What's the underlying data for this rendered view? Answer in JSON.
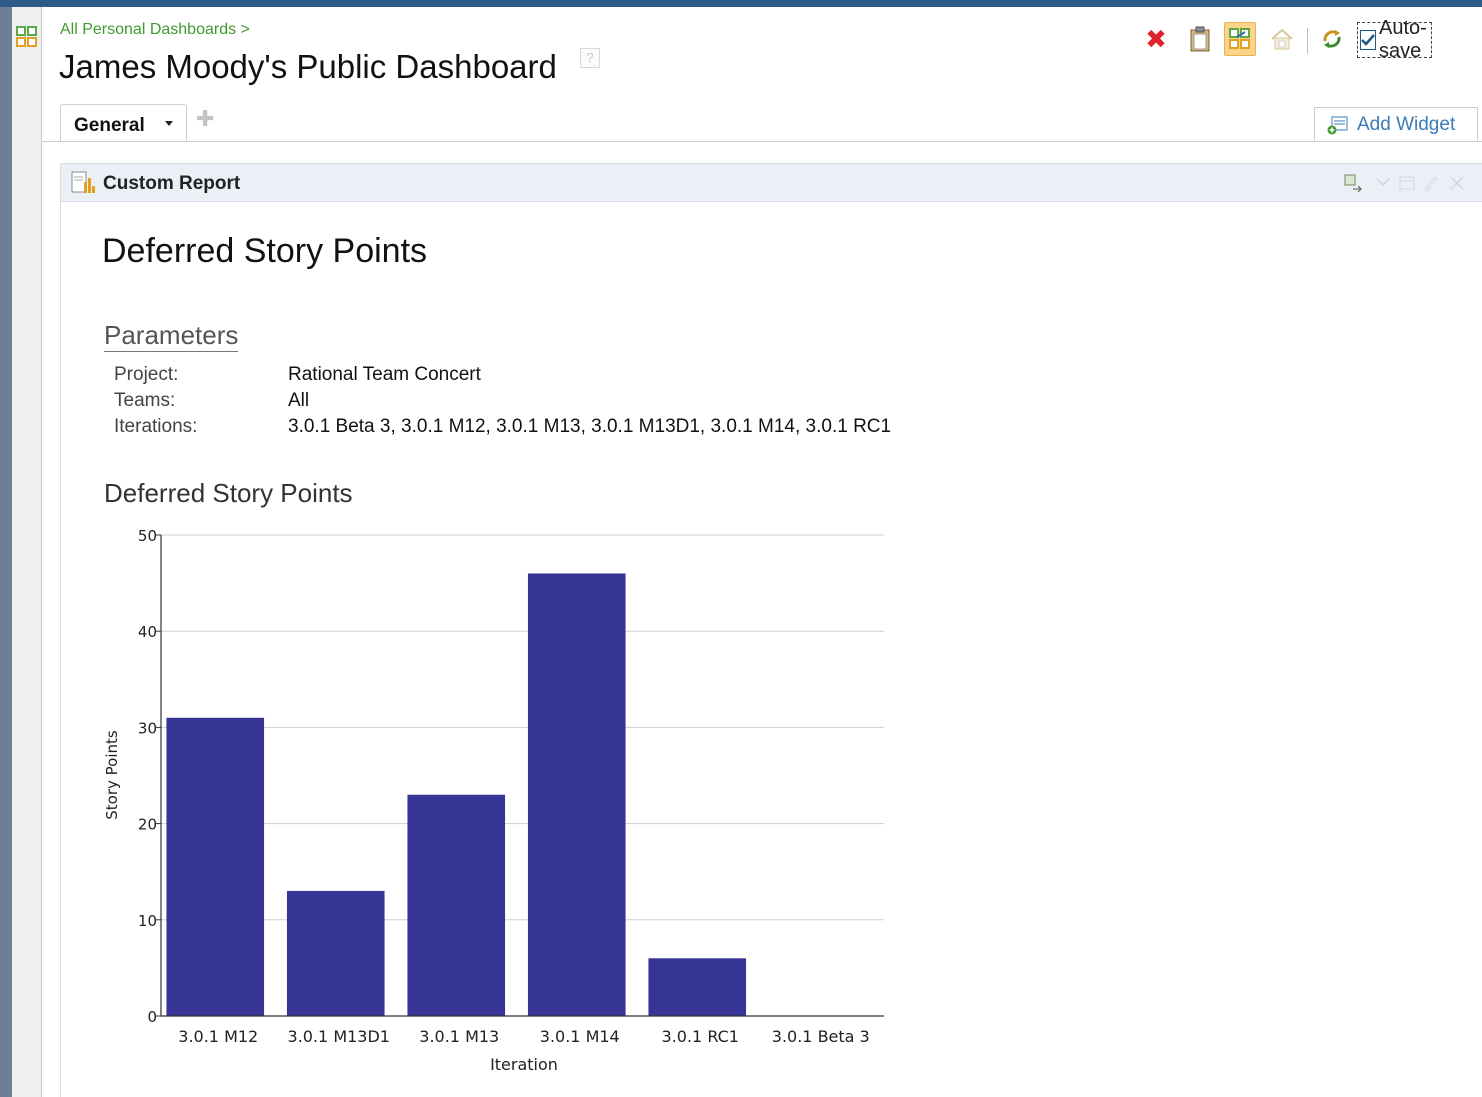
{
  "breadcrumb": "All Personal Dashboards >",
  "page": {
    "title": "James Moody's Public Dashboard",
    "help": "?"
  },
  "toolbar": {
    "autosave_label": "Auto-save",
    "autosave_checked": true
  },
  "tabs": [
    {
      "label": "General",
      "selected": true
    }
  ],
  "add_widget_label": "Add Widget",
  "widget": {
    "title": "Custom Report"
  },
  "report": {
    "title": "Deferred Story Points",
    "parameters_heading": "Parameters",
    "parameters": [
      {
        "label": "Project:",
        "value": "Rational Team Concert"
      },
      {
        "label": "Teams:",
        "value": "All"
      },
      {
        "label": "Iterations:",
        "value": "3.0.1 Beta 3, 3.0.1 M12, 3.0.1 M13, 3.0.1 M13D1, 3.0.1 M14, 3.0.1 RC1"
      }
    ]
  },
  "chart_data": {
    "type": "bar",
    "title": "Deferred Story Points",
    "xlabel": "Iteration",
    "ylabel": "Story Points",
    "categories": [
      "3.0.1 M12",
      "3.0.1 M13D1",
      "3.0.1 M13",
      "3.0.1 M14",
      "3.0.1 RC1",
      "3.0.1 Beta 3"
    ],
    "values": [
      31,
      13,
      23,
      46,
      6,
      0
    ],
    "ylim": [
      0,
      50
    ],
    "yticks": [
      0,
      10,
      20,
      30,
      40,
      50
    ],
    "grid": true,
    "bar_color": "#363494"
  },
  "colors": {
    "breadcrumb": "#3e9a2e",
    "link": "#3b7bb8",
    "header_bg": "#eaf0f6"
  }
}
